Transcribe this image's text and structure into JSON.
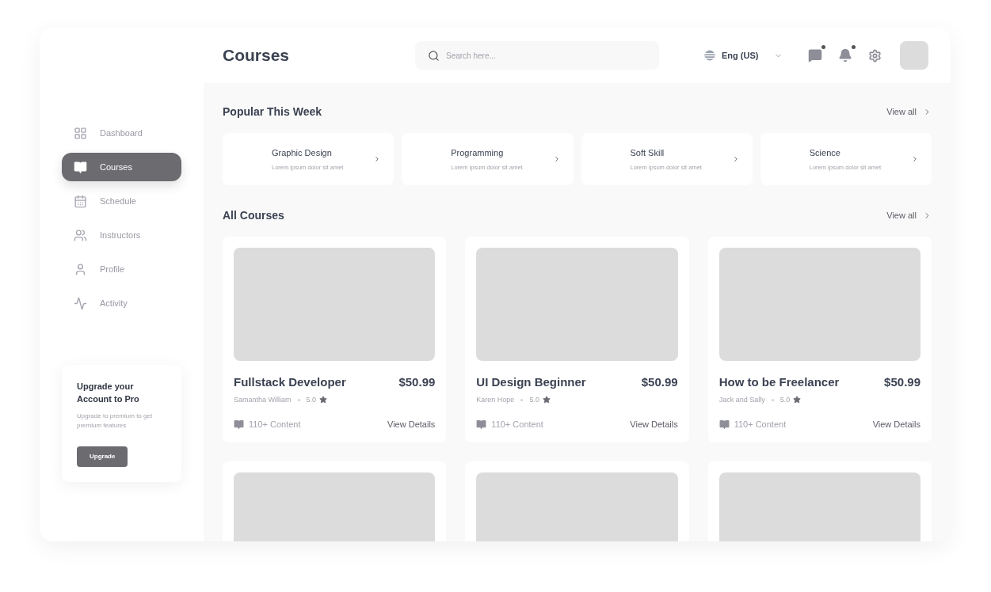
{
  "header": {
    "title": "Courses",
    "search": {
      "placeholder": "Search here..."
    },
    "language": "Eng (US)",
    "chat_unread": true,
    "notifications_unread": true
  },
  "sidebar": {
    "items": [
      {
        "label": "Dashboard",
        "selected": false
      },
      {
        "label": "Courses",
        "selected": true
      },
      {
        "label": "Schedule",
        "selected": false
      },
      {
        "label": "Instructors",
        "selected": false
      },
      {
        "label": "Profile",
        "selected": false
      },
      {
        "label": "Activity",
        "selected": false
      }
    ],
    "upgrade": {
      "title": "Upgrade your Account to Pro",
      "text": "Upgrade to premium to get premium features",
      "button": "Upgrade"
    }
  },
  "popular": {
    "title": "Popular This Week",
    "view_all": "View all",
    "items": [
      {
        "name": "Graphic Design",
        "description": "Lorem ipsum dolor sit amet"
      },
      {
        "name": "Programming",
        "description": "Lorem ipsum dolor sit amet"
      },
      {
        "name": "Soft Skill",
        "description": "Lorem ipsum dolor sit amet"
      },
      {
        "name": "Science",
        "description": "Lorem ipsum dolor sit amet"
      }
    ]
  },
  "all_courses": {
    "title": "All Courses",
    "view_all": "View all",
    "courses": [
      {
        "kind": "full",
        "title": "Fullstack Developer",
        "price": "$50.99",
        "author": "Samantha William",
        "rating": "5.0",
        "content": "110+ Content",
        "action": "View Details"
      },
      {
        "kind": "full",
        "title": "UI Design Beginner",
        "price": "$50.99",
        "author": "Karen Hope",
        "rating": "5.0",
        "content": "110+ Content",
        "action": "View Details"
      },
      {
        "kind": "full",
        "title": "How to be Freelancer",
        "price": "$50.99",
        "author": "Jack and Sally",
        "rating": "5.0",
        "content": "110+ Content",
        "action": "View Details"
      },
      {
        "kind": "cut"
      },
      {
        "kind": "cut"
      },
      {
        "kind": "cut"
      }
    ]
  }
}
